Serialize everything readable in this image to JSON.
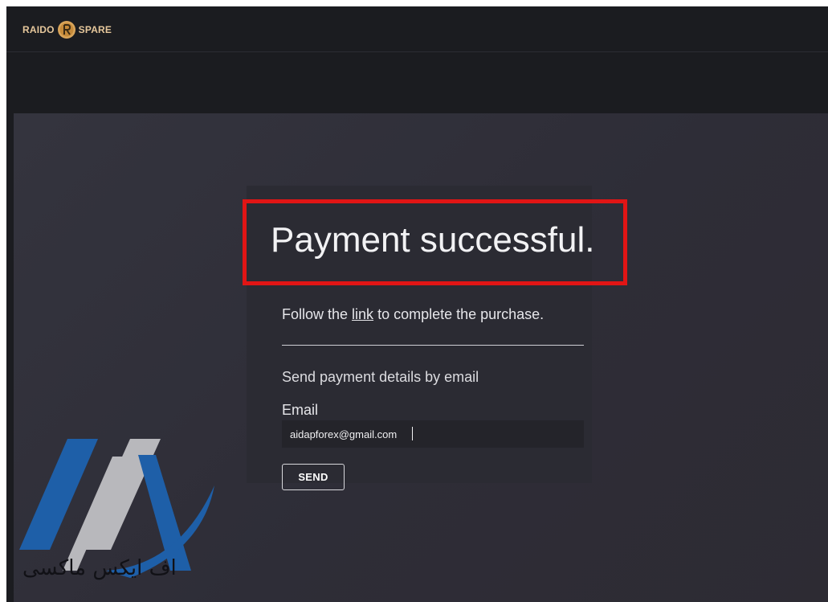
{
  "header": {
    "logo_left": "RAIDO",
    "logo_right": "SPARE",
    "logo_icon": "r-coin-icon",
    "brand_color": "#e6c79b"
  },
  "main": {
    "title": "Payment successful.",
    "follow_before": "Follow the ",
    "follow_link": "link",
    "follow_after": " to complete the purchase.",
    "send_heading": "Send payment details by email",
    "email_label": "Email",
    "email_value": "aidapforex@gmail.com",
    "send_button": "SEND",
    "highlight_color": "#e11515"
  },
  "watermark": {
    "logo_icon": "aia-logo-icon",
    "text": "اف ایکس ماکسی"
  }
}
